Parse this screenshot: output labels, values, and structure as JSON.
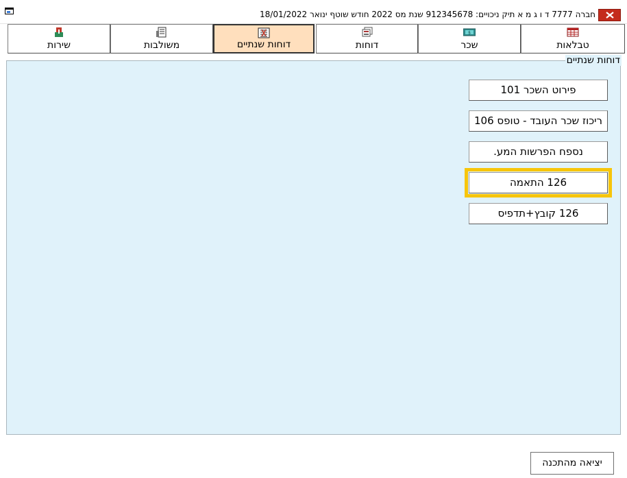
{
  "window": {
    "title": "חברה 7777 ד ו ג מ א  תיק ניכויים: 912345678   שנת מס 2022   חודש שוטף ינואר          18/01/2022"
  },
  "tabs": [
    {
      "label": "טבלאות",
      "icon": "table-icon"
    },
    {
      "label": "שכר",
      "icon": "salary-icon"
    },
    {
      "label": "דוחות",
      "icon": "reports-icon"
    },
    {
      "label": "דוחות שנתיים",
      "icon": "annual-reports-icon",
      "active": true
    },
    {
      "label": "משולבות",
      "icon": "combined-icon"
    },
    {
      "label": "שירות",
      "icon": "service-icon"
    }
  ],
  "panel": {
    "title": "דוחות שנתיים",
    "buttons": [
      {
        "label": "פירוט השכר 101"
      },
      {
        "label": "ריכוז שכר העובד - טופס 106"
      },
      {
        "label": "נספח הפרשות המע."
      },
      {
        "label": "126 התאמה",
        "highlighted": true
      },
      {
        "label": "126 קובץ+תדפיס"
      }
    ]
  },
  "footer": {
    "exit_label": "יציאה מהתכנה"
  },
  "colors": {
    "panel_bg": "#e0f2fa",
    "active_tab_bg": "#ffdfbd",
    "highlight": "#f7c50a",
    "close_red": "#c42b1c"
  }
}
